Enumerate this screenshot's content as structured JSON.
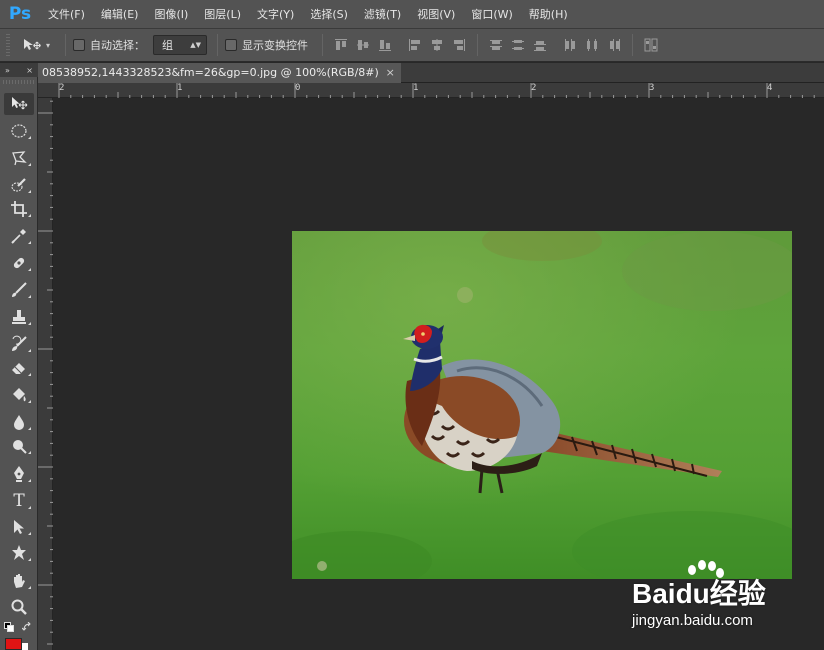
{
  "app": {
    "logo": "Ps",
    "menu": [
      "文件(F)",
      "编辑(E)",
      "图像(I)",
      "图层(L)",
      "文字(Y)",
      "选择(S)",
      "滤镜(T)",
      "视图(V)",
      "窗口(W)",
      "帮助(H)"
    ]
  },
  "options": {
    "auto_select_label": "自动选择：",
    "auto_select_checked": false,
    "group_value": "组",
    "show_transform_label": "显示变换控件",
    "show_transform_checked": false
  },
  "document": {
    "tab_title": "08538952,1443328523&fm=26&gp=0.jpg @ 100%(RGB/8#)",
    "close_glyph": "×"
  },
  "toolbox": {
    "header_collapse": "»",
    "header_close": "×",
    "tools": [
      "move-tool",
      "elliptical-marquee-tool",
      "lasso-tool",
      "quick-selection-tool",
      "crop-tool",
      "eyedropper-tool",
      "healing-brush-tool",
      "brush-tool",
      "clone-stamp-tool",
      "history-brush-tool",
      "eraser-tool",
      "paint-bucket-tool",
      "blur-tool",
      "dodge-tool",
      "pen-tool",
      "type-tool",
      "path-selection-tool",
      "custom-shape-tool",
      "hand-tool",
      "zoom-tool"
    ],
    "type_tool_glyph": "T",
    "foreground_color": "#e11414",
    "background_color": "#ffffff"
  },
  "ruler": {
    "top_labels": [
      "2",
      "1",
      "0",
      "1",
      "2",
      "3",
      "4"
    ],
    "left_labels": [
      "1",
      "0",
      "1",
      "2",
      "3"
    ]
  },
  "watermark": {
    "brand": "Baidu经验",
    "url": "jingyan.baidu.com"
  }
}
